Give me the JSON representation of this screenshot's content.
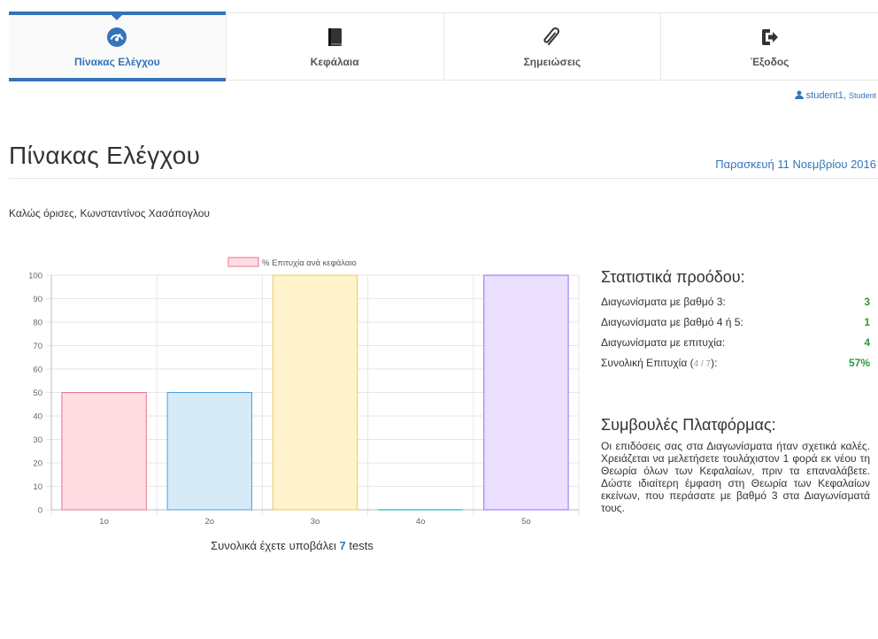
{
  "nav": {
    "tabs": [
      {
        "label": "Πίνακας Ελέγχου",
        "icon": "dashboard-icon",
        "active": true
      },
      {
        "label": "Κεφάλαια",
        "icon": "book-icon",
        "active": false
      },
      {
        "label": "Σημειώσεις",
        "icon": "paperclip-icon",
        "active": false
      },
      {
        "label": "Έξοδος",
        "icon": "sign-out-icon",
        "active": false
      }
    ]
  },
  "user": {
    "name": "student1",
    "role": "Student",
    "icon": "user-icon"
  },
  "page": {
    "title": "Πίνακας Ελέγχου",
    "date": "Παρασκευή 11 Νοεμβρίου 2016",
    "welcome": "Καλώς όρισες, Κωνσταντίνος Χασάπογλου"
  },
  "chart_data": {
    "type": "bar",
    "categories": [
      "1ο",
      "2ο",
      "3ο",
      "4ο",
      "5ο"
    ],
    "series": [
      {
        "name": "% Επιτυχία ανά κεφάλαιο",
        "values": [
          50,
          50,
          100,
          0,
          100
        ]
      }
    ],
    "bar_fills": [
      "#ffdde3",
      "#d6eaf8",
      "#fff3cc",
      "#d9f1f1",
      "#ebe0ff"
    ],
    "bar_strokes": [
      "#e8718c",
      "#4ea0dd",
      "#f5c753",
      "#56bfbf",
      "#9966ff"
    ],
    "legend_fill": "#ffdde3",
    "legend_stroke": "#e8718c",
    "yticks": [
      "0",
      "10",
      "20",
      "30",
      "40",
      "50",
      "60",
      "70",
      "80",
      "90",
      "100"
    ],
    "ylim": [
      0,
      100
    ],
    "grid": true,
    "legend_position": "top"
  },
  "chart_caption": {
    "prefix": "Συνολικά έχετε υποβάλει",
    "count": "7",
    "suffix": "tests"
  },
  "stats": {
    "title": "Στατιστικά προόδου:",
    "rows": [
      {
        "label": "Διαγωνίσματα με βαθμό 3:",
        "value": "3"
      },
      {
        "label": "Διαγωνίσματα με βαθμό 4 ή 5:",
        "value": "1"
      },
      {
        "label": "Διαγωνίσματα με επιτυχία:",
        "value": "4"
      }
    ],
    "total": {
      "label": "Συνολική Επιτυχία",
      "frac_open": "(",
      "fraction": "4 / 7",
      "frac_close": "):",
      "value": "57%"
    }
  },
  "tips": {
    "title": "Συμβουλές Πλατφόρμας:",
    "text": "Οι επιδόσεις σας στα Διαγωνίσματα ήταν σχετικά καλές. Χρειάζεται να μελετήσετε τουλάχιστον 1 φορά εκ νέου τη Θεωρία όλων των Κεφαλαίων, πριν τα επαναλάβετε. Δώστε ιδιαίτερη έμφαση στη Θεωρία των Κεφαλαίων εκείνων, που περάσατε με βαθμό 3 στα Διαγωνίσματά τους."
  },
  "colors": {
    "accent": "#3474b9",
    "success": "#2d9b36"
  }
}
